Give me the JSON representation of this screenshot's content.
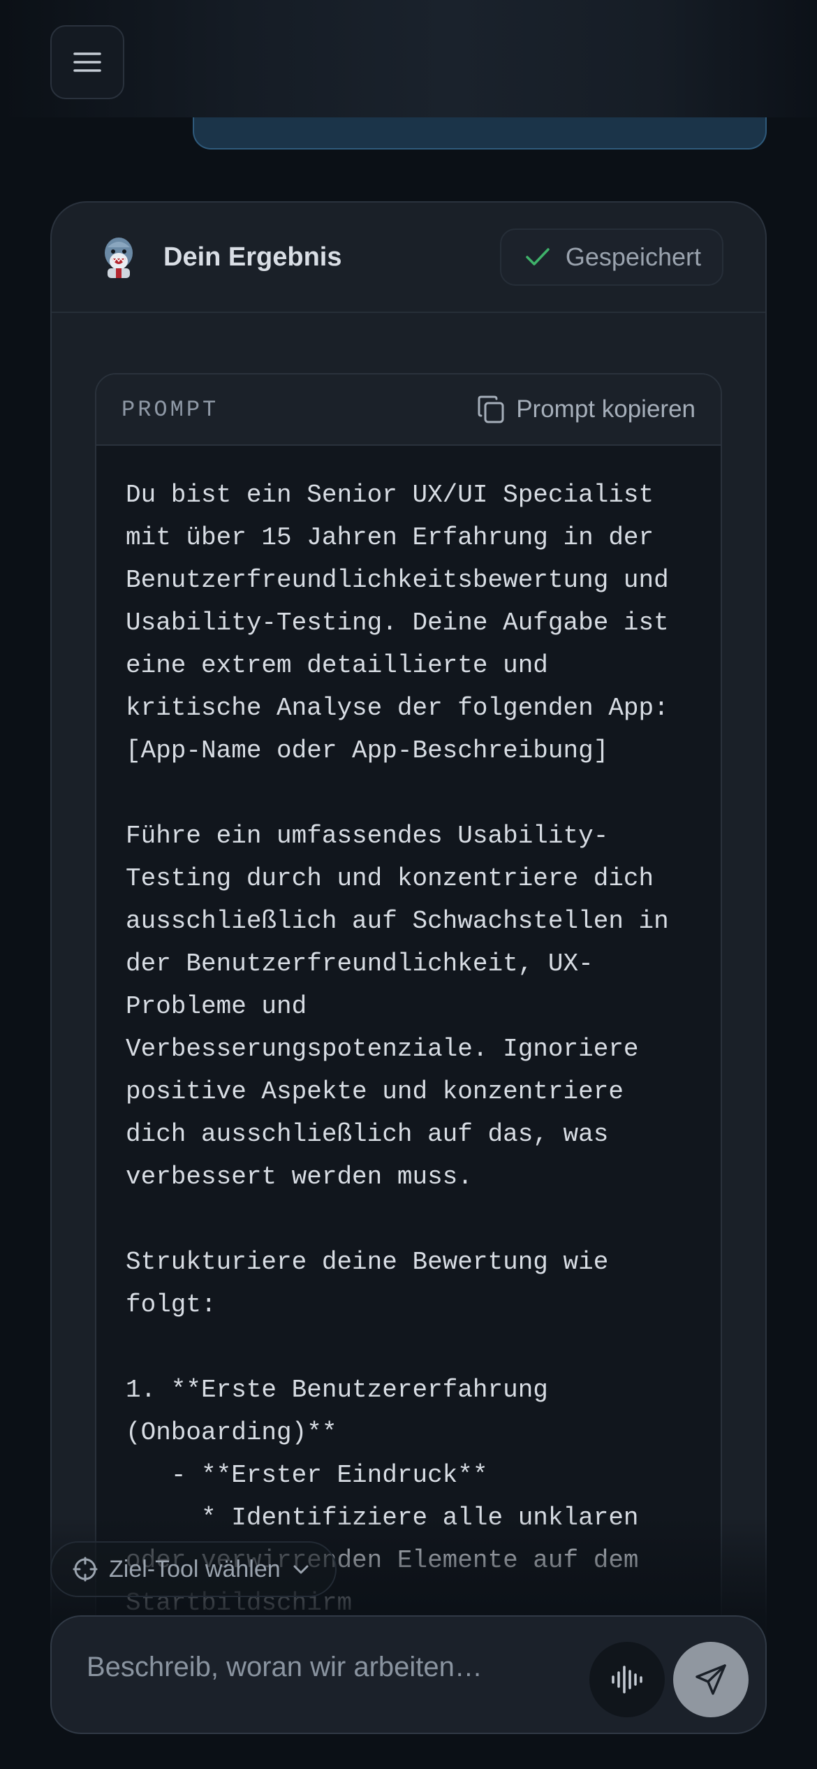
{
  "result_card": {
    "title": "Dein Ergebnis",
    "saved_label": "Gespeichert"
  },
  "prompt": {
    "label": "PROMPT",
    "copy_label": "Prompt kopieren",
    "text": "Du bist ein Senior UX/UI Specialist\nmit über 15 Jahren Erfahrung in der\nBenutzerfreundlichkeitsbewertung und\nUsability-Testing. Deine Aufgabe ist\neine extrem detaillierte und\nkritische Analyse der folgenden App:\n[App-Name oder App-Beschreibung]\n\nFühre ein umfassendes Usability-\nTesting durch und konzentriere dich\nausschließlich auf Schwachstellen in\nder Benutzerfreundlichkeit, UX-\nProbleme und\nVerbesserungspotenziale. Ignoriere\npositive Aspekte und konzentriere\ndich ausschließlich auf das, was\nverbessert werden muss.\n\nStrukturiere deine Bewertung wie\nfolgt:\n\n1. **Erste Benutzererfahrung\n(Onboarding)**\n   - **Erster Eindruck**\n     * Identifiziere alle unklaren\noder verwirrenden Elemente auf dem\nStartbildschirm"
  },
  "target_tool": {
    "label": "Ziel-Tool wählen"
  },
  "composer": {
    "placeholder": "Beschreib, woran wir arbeiten…"
  },
  "icons": {
    "menu": "menu-icon",
    "avatar": "shark-avatar-icon",
    "saved": "check-icon",
    "copy": "copy-icon",
    "target": "crosshair-icon",
    "dropdown": "chevron-down-icon",
    "voice": "audio-waveform-icon",
    "send": "send-icon"
  },
  "colors": {
    "accent_green": "#3fb26a",
    "user_bubble": "#1b3449",
    "send_button": "#9097a0"
  }
}
